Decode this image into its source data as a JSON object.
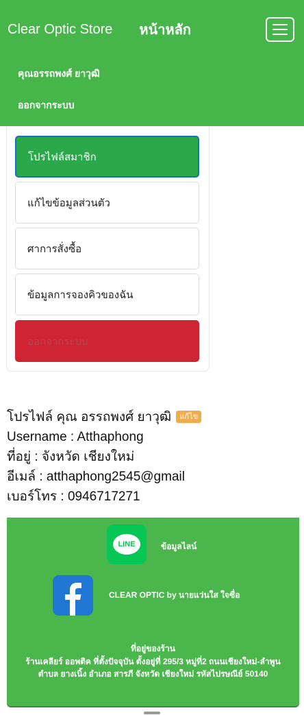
{
  "navbar": {
    "brand": "Clear Optic Store",
    "home": "หน้าหลัก",
    "user_link": "คุณอรรถพงศ์ ยาวุฒิ",
    "logout_link": "ออกจากระบบ"
  },
  "menu": {
    "items": [
      {
        "label": "โปรไฟล์สมาชิก"
      },
      {
        "label": "แก้ไขข้อมูลส่วนตัว"
      },
      {
        "label": "ศาการสั่งซื้อ"
      },
      {
        "label": "ข้อมูลการจองคิวของฉัน"
      },
      {
        "label": "ออกจากระบบ"
      }
    ]
  },
  "profile": {
    "heading": "โปรไฟล์ คุณ อรรถพงศ์ ยาวุฒิ",
    "edit_badge": "แก้ไข",
    "username": "Username : Atthaphong",
    "address": "ที่อยู่ : จังหวัด เชียงใหม่",
    "email": "อีเมล์ : atthaphong2545@gmail",
    "phone": "เบอร์โทร : 0946717271"
  },
  "footer": {
    "line_badge": "LINE",
    "line_label": "ข้อมูลไลน์",
    "facebook_label": "CLEAR OPTIC by นายแว่นใส ใจซื่อ",
    "address_title": "ที่อยู่ของร้าน",
    "address_text": "ร้านเคลียร์ ออพติค ที่ตั้งปัจจุบัน ตั้งอยู่ที่ 295/3 หมู่ที่2 ถนนเชียงใหม่-ลำพูน ตำบล ยางเนิ้ง อำเภอ สารภี จังหวัด เชียงใหม่ รหัสไปรษณีย์ 50140"
  },
  "colors": {
    "brand_green": "#46b64a",
    "active_green": "#2aa84a",
    "danger_red": "#ce2433",
    "badge_orange": "#f0ad4e",
    "line_green": "#06c755",
    "facebook_blue": "#1f77d3"
  }
}
